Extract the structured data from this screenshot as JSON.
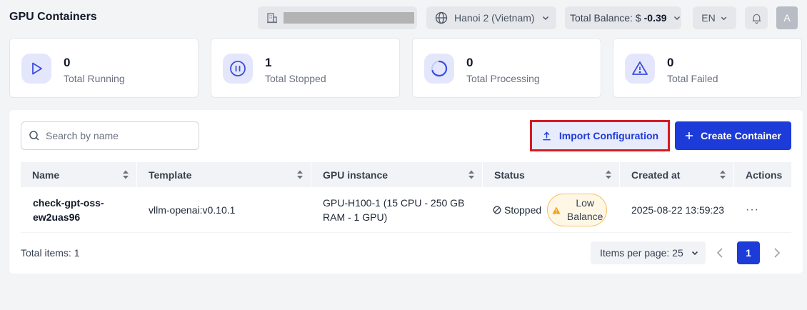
{
  "header": {
    "title": "GPU Containers",
    "region": "Hanoi 2 (Vietnam)",
    "balance_label": "Total Balance: $",
    "balance_value": "-0.39",
    "language": "EN",
    "avatar_initial": "A"
  },
  "stats": [
    {
      "value": "0",
      "label": "Total Running",
      "icon": "play-icon"
    },
    {
      "value": "1",
      "label": "Total Stopped",
      "icon": "pause-icon"
    },
    {
      "value": "0",
      "label": "Total Processing",
      "icon": "spinner-icon"
    },
    {
      "value": "0",
      "label": "Total Failed",
      "icon": "warning-icon"
    }
  ],
  "toolbar": {
    "search_placeholder": "Search by name",
    "import_label": "Import Configuration",
    "create_label": "Create Container"
  },
  "table": {
    "columns": [
      "Name",
      "Template",
      "GPU instance",
      "Status",
      "Created at",
      "Actions"
    ],
    "rows": [
      {
        "name": "check-gpt-oss-ew2uas96",
        "template": "vllm-openai:v0.10.1",
        "gpu_instance": "GPU-H100-1 (15 CPU - 250 GB RAM - 1 GPU)",
        "status": "Stopped",
        "badge": "Low Balance",
        "created_at": "2025-08-22 13:59:23",
        "actions": "···"
      }
    ]
  },
  "footer": {
    "total_items": "Total items: 1",
    "items_per_page": "Items per page: 25",
    "current_page": "1"
  },
  "colors": {
    "primary": "#1d3bd8",
    "highlight_border": "#d71920",
    "warning": "#f59e0b"
  }
}
